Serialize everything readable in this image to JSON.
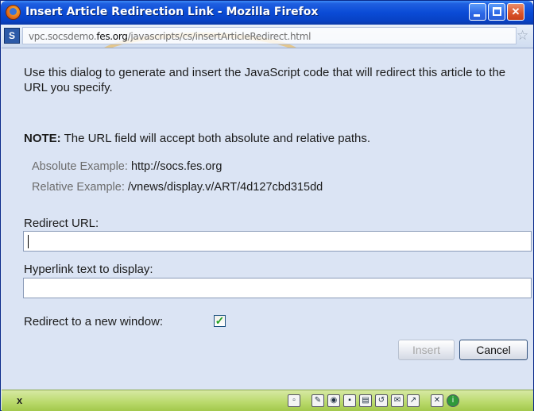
{
  "window": {
    "title": "Insert Article Redirection Link - Mozilla Firefox",
    "controls": {
      "minimize": "minimize",
      "maximize": "maximize",
      "close": "close"
    }
  },
  "addressbar": {
    "url_prefix": "vpc.socsdemo.",
    "url_domain": "fes.org",
    "url_path": "/javascripts/cs/insertArticleRedirect.html",
    "site_icon": "S"
  },
  "dialog": {
    "intro": "Use this dialog to generate and insert the JavaScript code that will redirect this article to the URL you specify.",
    "note_label": "NOTE:",
    "note_text": " The URL field will accept both absolute and relative paths.",
    "absolute_label": "Absolute Example:",
    "absolute_value": "http://socs.fes.org",
    "relative_label": "Relative Example:",
    "relative_value": "/vnews/display.v/ART/4d127cbd315dd",
    "redirect_url_label": "Redirect URL:",
    "redirect_url_value": "",
    "hyperlink_label": "Hyperlink text to display:",
    "hyperlink_value": "",
    "new_window_label": "Redirect to a new window:",
    "new_window_checked": true,
    "insert_label": "Insert",
    "cancel_label": "Cancel"
  },
  "statusbar": {
    "left_text": "x"
  },
  "colors": {
    "titlebar": "#0a4bd6",
    "content_bg": "#dbe4f4",
    "statusbar": "#b9d96a",
    "checkbox_mark": "#21a121"
  }
}
